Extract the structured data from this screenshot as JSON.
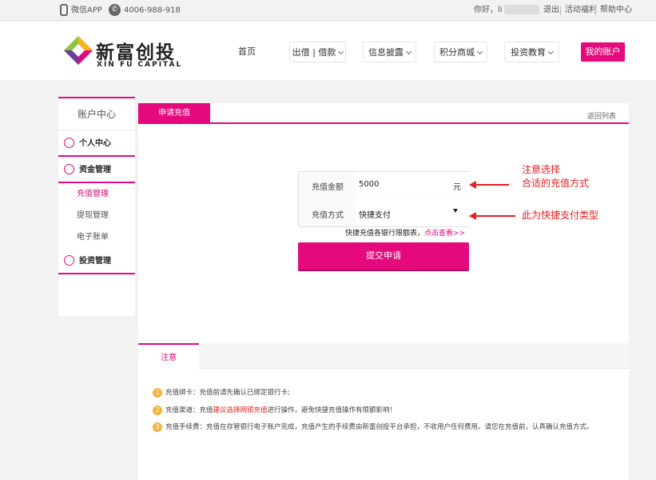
{
  "topbar": {
    "wechat_app": "微信APP",
    "phone": "4006-988-918",
    "greeting": "你好，li",
    "logout": "退出",
    "activity": "活动福利",
    "help": "帮助中心"
  },
  "logo": {
    "cn": "新富创投",
    "en": "XIN FU CAPITAL"
  },
  "nav": {
    "home": "首页",
    "lend": "出借 | 借款",
    "disclosure": "信息披露",
    "mall": "积分商城",
    "education": "投资教育",
    "my_account": "我的账户"
  },
  "sidebar": {
    "title": "账户中心",
    "personal": "个人中心",
    "funds": "资金管理",
    "recharge": "充值管理",
    "withdraw": "提现管理",
    "statement": "电子账单",
    "invest": "投资管理"
  },
  "main": {
    "tab": "申请充值",
    "back": "返回列表",
    "amount_label": "充值金额",
    "amount_value": "5000",
    "amount_unit": "元",
    "method_label": "充值方式",
    "method_value": "快捷支付",
    "quick_note": "快捷充值各银行限额表，",
    "quick_link": "点击查看>>",
    "submit": "提交申请"
  },
  "annotations": {
    "line1": "注意选择",
    "line2": "合适的充值方式",
    "line3": "此为快捷支付类型",
    "color": "#e42020"
  },
  "notice": {
    "tab": "注意",
    "item1_num": "1",
    "item1": "充值绑卡：充值前请先确认已绑定银行卡;",
    "item2_num": "2",
    "item2_pre": "充值渠道：充值",
    "item2_hl": "建议选择网银充值",
    "item2_post": "进行操作，避免快捷充值操作有限额影响！",
    "item3_num": "3",
    "item3": "充值手续费：充值在存管银行电子账户完成，充值产生的手续费由新富创投平台承担，不收用户任何费用。请您在充值前，认真确认充值方式。"
  },
  "colors": {
    "brand": "#e4097c"
  }
}
